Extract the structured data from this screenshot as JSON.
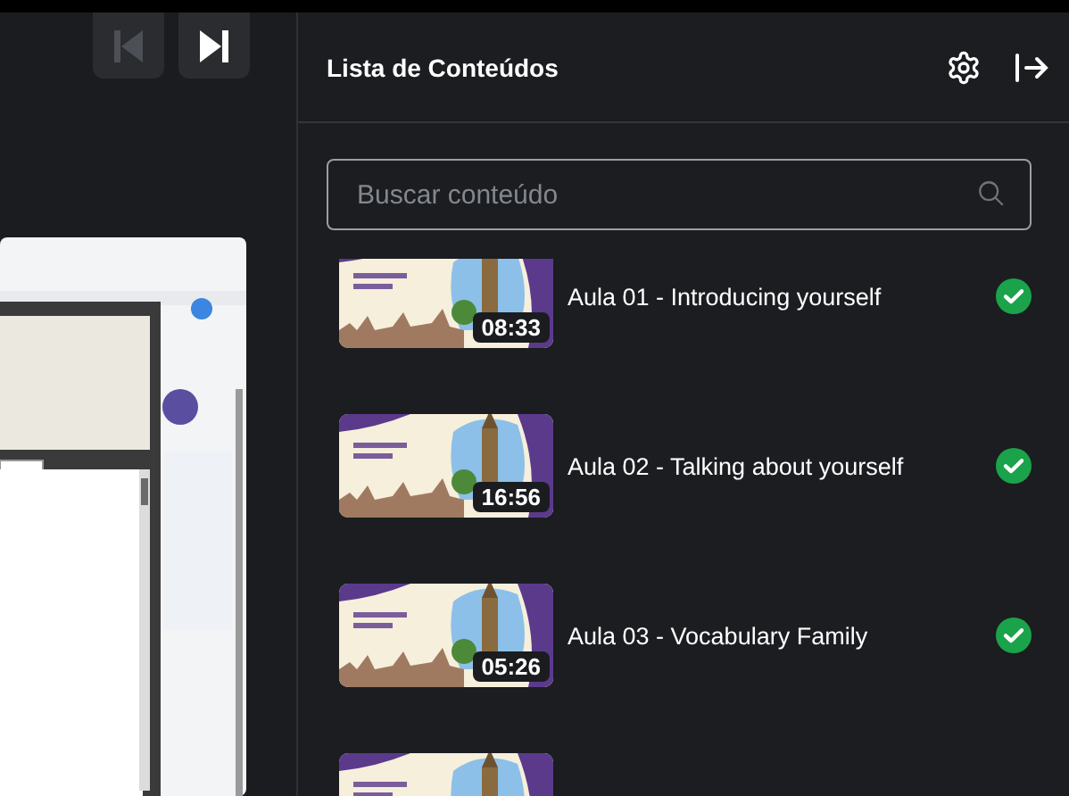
{
  "player": {
    "prev_button": {
      "disabled": true
    },
    "next_button": {
      "disabled": false
    }
  },
  "sidebar": {
    "title": "Lista de Conteúdos",
    "search": {
      "placeholder": "Buscar conteúdo"
    },
    "items": [
      {
        "kind": "lesson",
        "title": "Aula 01 - Introducing yourself",
        "duration": "08:33",
        "completed": true
      },
      {
        "kind": "lesson",
        "title": "Aula 02 - Talking about yourself",
        "duration": "16:56",
        "completed": true
      },
      {
        "kind": "lesson",
        "title": "Aula 03 - Vocabulary Family",
        "duration": "05:26",
        "completed": true
      },
      {
        "kind": "thumbnail"
      }
    ]
  }
}
